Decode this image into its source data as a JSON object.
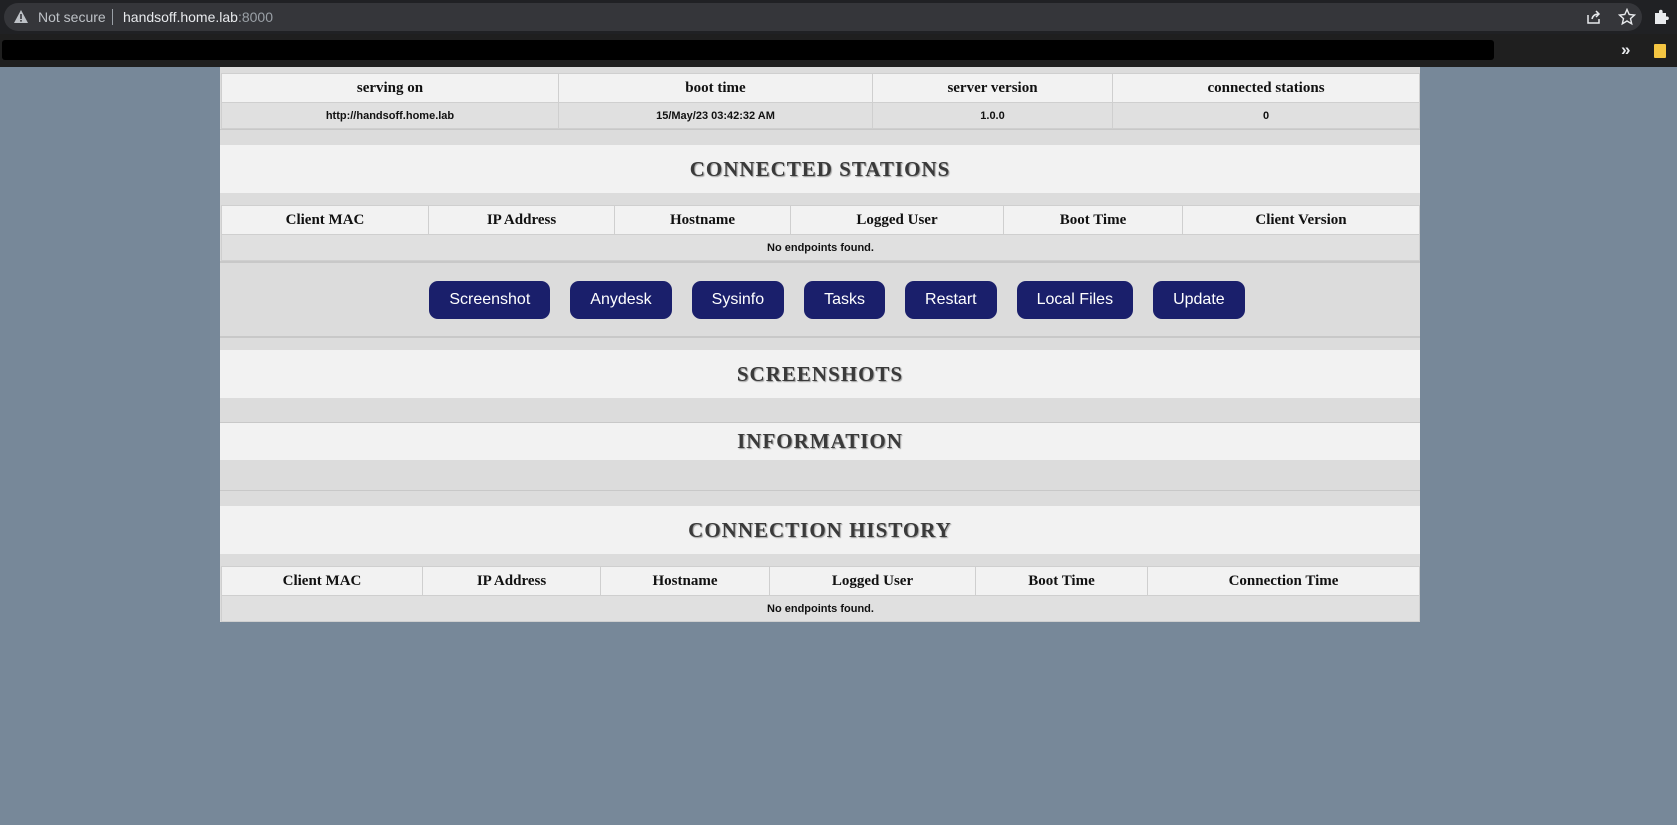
{
  "browser": {
    "security_label": "Not secure",
    "url_host": "handsoff.home.lab",
    "url_port": ":8000",
    "bookmarks_overflow": "»"
  },
  "status": {
    "headers": [
      "serving on",
      "boot time",
      "server version",
      "connected stations"
    ],
    "values": [
      "http://handsoff.home.lab",
      "15/May/23 03:42:32 AM",
      "1.0.0",
      "0"
    ]
  },
  "connected_stations": {
    "title": "CONNECTED STATIONS",
    "headers": [
      "Client MAC",
      "IP Address",
      "Hostname",
      "Logged User",
      "Boot Time",
      "Client Version"
    ],
    "empty_message": "No endpoints found."
  },
  "actions": [
    "Screenshot",
    "Anydesk",
    "Sysinfo",
    "Tasks",
    "Restart",
    "Local Files",
    "Update"
  ],
  "screenshots": {
    "title": "SCREENSHOTS"
  },
  "information": {
    "title": "INFORMATION"
  },
  "connection_history": {
    "title": "CONNECTION HISTORY",
    "headers": [
      "Client MAC",
      "IP Address",
      "Hostname",
      "Logged User",
      "Boot Time",
      "Connection Time"
    ],
    "empty_message": "No endpoints found."
  },
  "colors": {
    "page_background": "#778899",
    "button_background": "#1a1f6b",
    "panel_background": "#dcdcdc"
  }
}
